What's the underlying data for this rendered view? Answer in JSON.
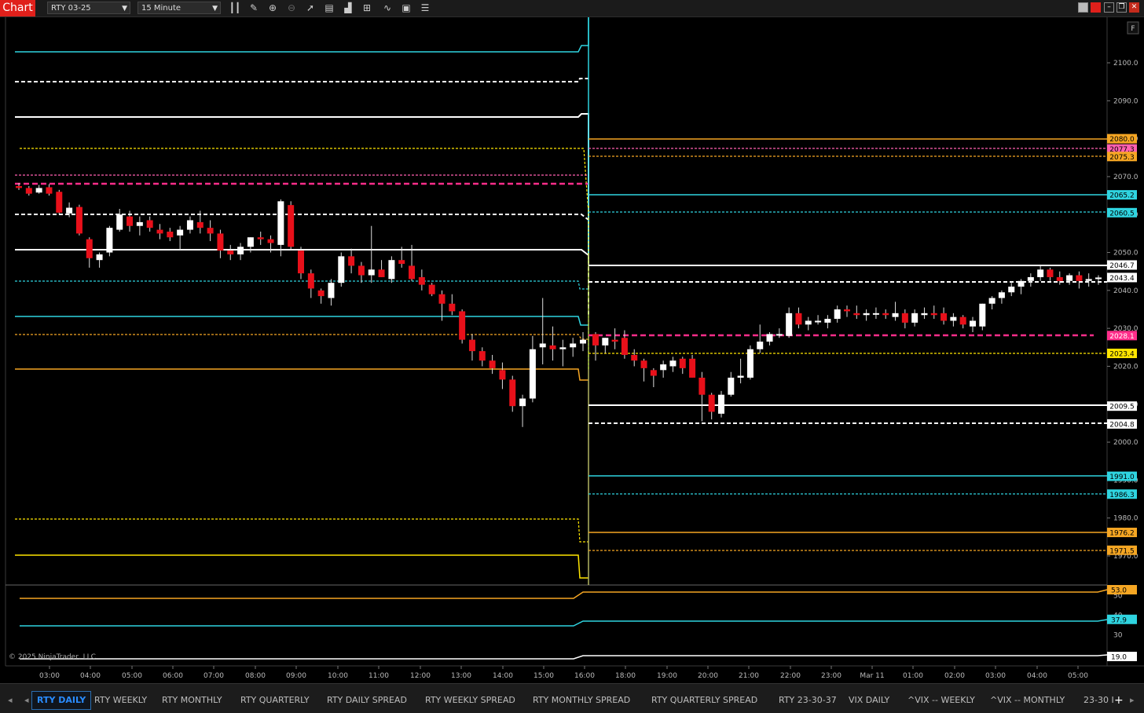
{
  "window": {
    "chart_button": "Chart",
    "instrument": "RTY 03-25",
    "interval": "15 Minute",
    "toolbar_icons": [
      "bars-icon",
      "pencil-icon",
      "zoom-in-icon",
      "zoom-out-icon",
      "pointer-icon",
      "properties-icon",
      "indicators-icon",
      "strategies-icon",
      "drawing-tools-icon",
      "templates-icon",
      "data-box-icon"
    ]
  },
  "price_axis": {
    "ticks": [
      "2100.0",
      "2090.0",
      "2080.0",
      "2070.0",
      "2060.0",
      "2050.0",
      "2040.0",
      "2030.0",
      "2020.0",
      "2010.0",
      "2000.0",
      "1990.0",
      "1980.0",
      "1970.0"
    ],
    "corner_button": "F"
  },
  "price_labels": [
    {
      "text": "2080.0",
      "color": "#f5a623"
    },
    {
      "text": "2077.3",
      "color": "#ff5fb0"
    },
    {
      "text": "2075.3",
      "color": "#f5a623"
    },
    {
      "text": "2065.2",
      "color": "#2fd4e0"
    },
    {
      "text": "2060.5",
      "color": "#2fd4e0"
    },
    {
      "text": "2046.7",
      "color": "#ffffff"
    },
    {
      "text": "2043.4",
      "color": "#ffffff"
    },
    {
      "text": "2028.1",
      "color": "#ff2d8a"
    },
    {
      "text": "2023.4",
      "color": "#ffe600"
    },
    {
      "text": "2009.5",
      "color": "#ffffff"
    },
    {
      "text": "2004.8",
      "color": "#ffffff"
    },
    {
      "text": "1991.0",
      "color": "#2fd4e0"
    },
    {
      "text": "1986.3",
      "color": "#2fd4e0"
    },
    {
      "text": "1976.2",
      "color": "#f5a623"
    },
    {
      "text": "1971.5",
      "color": "#f5a623"
    }
  ],
  "lower_panel": {
    "ticks": [
      "50",
      "40",
      "30"
    ],
    "labels": [
      {
        "text": "53.0",
        "color": "#f5a623"
      },
      {
        "text": "37.9",
        "color": "#2fd4e0"
      },
      {
        "text": "19.0",
        "color": "#ffffff"
      }
    ],
    "copyright": "© 2025 NinjaTrader, LLC"
  },
  "time_axis": [
    "03:00",
    "04:00",
    "05:00",
    "06:00",
    "07:00",
    "08:00",
    "09:00",
    "10:00",
    "11:00",
    "12:00",
    "13:00",
    "14:00",
    "15:00",
    "16:00",
    "18:00",
    "19:00",
    "20:00",
    "21:00",
    "22:00",
    "23:00",
    "Mar 11",
    "01:00",
    "02:00",
    "03:00",
    "04:00",
    "05:00"
  ],
  "tabs": [
    "RTY DAILY",
    "RTY WEEKLY",
    "RTY MONTHLY",
    "RTY QUARTERLY",
    "RTY DAILY SPREAD",
    "RTY WEEKLY SPREAD",
    "RTY MONTHLY SPREAD",
    "RTY QUARTERLY SPREAD",
    "RTY 23-30-37",
    "VIX DAILY",
    "^VIX -- WEEKLY",
    "^VIX -- MONTHLY",
    "23-30 I"
  ],
  "active_tab": "RTY DAILY",
  "colors": {
    "up": "#ffffff",
    "down": "#e8101a",
    "cyan": "#2fd4e0",
    "orange": "#f5a623",
    "magenta": "#ff2d8a",
    "yellow": "#ffe600"
  },
  "candles": [
    [
      2067.5,
      2068.3,
      2066.5,
      2067.0
    ],
    [
      2067.0,
      2067.5,
      2065.0,
      2065.5
    ],
    [
      2065.8,
      2067.8,
      2065.5,
      2067.0
    ],
    [
      2067.2,
      2068.0,
      2065.0,
      2065.5
    ],
    [
      2066.0,
      2066.5,
      2060.0,
      2060.5
    ],
    [
      2060.3,
      2063.2,
      2059.3,
      2061.8
    ],
    [
      2062.0,
      2062.6,
      2054.5,
      2055.0
    ],
    [
      2053.5,
      2054.0,
      2046.0,
      2048.5
    ],
    [
      2048.0,
      2050.0,
      2046.0,
      2049.5
    ],
    [
      2050.0,
      2057.0,
      2049.0,
      2056.5
    ],
    [
      2056.0,
      2061.5,
      2055.5,
      2060.0
    ],
    [
      2059.5,
      2061.0,
      2055.5,
      2057.0
    ],
    [
      2057.0,
      2059.5,
      2054.5,
      2058.0
    ],
    [
      2058.5,
      2059.5,
      2055.5,
      2056.5
    ],
    [
      2056.0,
      2057.5,
      2053.5,
      2055.0
    ],
    [
      2055.5,
      2056.5,
      2053.0,
      2054.0
    ],
    [
      2054.5,
      2057.0,
      2050.5,
      2056.0
    ],
    [
      2056.0,
      2059.5,
      2055.0,
      2058.5
    ],
    [
      2058.0,
      2061.0,
      2055.0,
      2056.5
    ],
    [
      2056.5,
      2058.5,
      2053.0,
      2055.0
    ],
    [
      2055.0,
      2056.0,
      2048.5,
      2050.5
    ],
    [
      2050.5,
      2052.0,
      2048.0,
      2049.5
    ],
    [
      2049.5,
      2052.5,
      2048.0,
      2051.5
    ],
    [
      2051.5,
      2054.0,
      2050.0,
      2054.0
    ],
    [
      2054.0,
      2055.5,
      2052.0,
      2053.5
    ],
    [
      2053.5,
      2054.5,
      2050.0,
      2052.5
    ],
    [
      2052.0,
      2064.0,
      2049.0,
      2063.5
    ],
    [
      2062.5,
      2063.5,
      2050.5,
      2051.5
    ],
    [
      2050.5,
      2051.5,
      2043.0,
      2044.5
    ],
    [
      2044.5,
      2045.5,
      2038.0,
      2040.5
    ],
    [
      2040.0,
      2040.5,
      2036.5,
      2038.5
    ],
    [
      2038.0,
      2043.0,
      2036.0,
      2042.0
    ],
    [
      2042.0,
      2050.0,
      2041.0,
      2049.0
    ],
    [
      2049.0,
      2051.0,
      2044.5,
      2046.5
    ],
    [
      2046.5,
      2047.5,
      2042.0,
      2044.0
    ],
    [
      2044.0,
      2057.0,
      2042.0,
      2045.5
    ],
    [
      2045.5,
      2048.0,
      2043.5,
      2043.5
    ],
    [
      2043.0,
      2049.0,
      2042.0,
      2048.0
    ],
    [
      2048.0,
      2051.5,
      2046.0,
      2047.0
    ],
    [
      2046.5,
      2052.0,
      2042.5,
      2043.0
    ],
    [
      2043.5,
      2045.5,
      2040.0,
      2041.5
    ],
    [
      2041.5,
      2042.0,
      2038.5,
      2039.0
    ],
    [
      2039.0,
      2040.0,
      2032.0,
      2036.5
    ],
    [
      2036.5,
      2039.0,
      2033.5,
      2034.5
    ],
    [
      2034.5,
      2035.0,
      2026.0,
      2027.0
    ],
    [
      2027.0,
      2028.5,
      2021.5,
      2024.0
    ],
    [
      2024.0,
      2025.0,
      2020.0,
      2021.5
    ],
    [
      2021.5,
      2023.0,
      2018.0,
      2019.5
    ],
    [
      2019.0,
      2021.0,
      2014.0,
      2016.5
    ],
    [
      2016.5,
      2017.5,
      2008.0,
      2009.5
    ],
    [
      2009.5,
      2012.5,
      2004.0,
      2011.5
    ],
    [
      2011.5,
      2028.0,
      2010.5,
      2024.5
    ],
    [
      2025.0,
      2038.0,
      2020.5,
      2026.0
    ],
    [
      2025.5,
      2030.5,
      2021.5,
      2024.5
    ],
    [
      2024.5,
      2027.0,
      2020.0,
      2025.0
    ],
    [
      2025.0,
      2027.5,
      2022.5,
      2026.0
    ],
    [
      2026.0,
      2029.0,
      2024.0,
      2027.0
    ],
    [
      2028.5,
      2029.0,
      2021.5,
      2025.5
    ],
    [
      2025.5,
      2027.5,
      2023.5,
      2027.5
    ],
    [
      2027.0,
      2030.0,
      2024.5,
      2026.5
    ],
    [
      2027.5,
      2029.5,
      2022.0,
      2023.0
    ],
    [
      2023.0,
      2024.5,
      2020.0,
      2021.5
    ],
    [
      2021.5,
      2022.0,
      2016.0,
      2019.5
    ],
    [
      2019.0,
      2019.5,
      2014.5,
      2017.5
    ],
    [
      2019.0,
      2021.5,
      2017.0,
      2020.5
    ],
    [
      2020.0,
      2022.5,
      2018.5,
      2021.5
    ],
    [
      2022.0,
      2022.5,
      2018.0,
      2019.5
    ],
    [
      2022.0,
      2023.0,
      2017.0,
      2017.0
    ],
    [
      2017.0,
      2018.5,
      2005.5,
      2012.5
    ],
    [
      2012.5,
      2013.0,
      2006.0,
      2008.0
    ],
    [
      2007.5,
      2013.5,
      2006.5,
      2012.5
    ],
    [
      2012.5,
      2018.5,
      2012.0,
      2017.0
    ],
    [
      2017.0,
      2022.0,
      2015.5,
      2017.5
    ],
    [
      2017.0,
      2025.5,
      2016.5,
      2024.5
    ],
    [
      2024.5,
      2031.0,
      2023.5,
      2026.5
    ],
    [
      2026.5,
      2029.0,
      2025.5,
      2028.5
    ],
    [
      2028.5,
      2030.0,
      2027.5,
      2028.5
    ],
    [
      2028.0,
      2035.5,
      2027.5,
      2034.0
    ],
    [
      2034.0,
      2035.5,
      2030.0,
      2031.0
    ],
    [
      2031.0,
      2033.0,
      2029.5,
      2032.0
    ],
    [
      2032.0,
      2033.5,
      2031.0,
      2032.0
    ],
    [
      2031.5,
      2033.5,
      2030.0,
      2032.5
    ],
    [
      2032.5,
      2036.0,
      2031.5,
      2035.0
    ],
    [
      2035.0,
      2036.0,
      2033.0,
      2034.5
    ],
    [
      2034.0,
      2036.0,
      2032.5,
      2033.5
    ],
    [
      2033.5,
      2035.0,
      2032.0,
      2034.0
    ],
    [
      2034.0,
      2035.5,
      2032.5,
      2034.0
    ],
    [
      2034.0,
      2035.0,
      2032.5,
      2033.5
    ],
    [
      2033.0,
      2037.0,
      2032.0,
      2034.0
    ],
    [
      2034.0,
      2035.0,
      2030.0,
      2031.5
    ],
    [
      2031.5,
      2035.0,
      2030.5,
      2034.0
    ],
    [
      2033.5,
      2035.5,
      2032.5,
      2034.0
    ],
    [
      2034.0,
      2036.0,
      2032.5,
      2033.5
    ],
    [
      2034.0,
      2035.5,
      2031.0,
      2032.0
    ],
    [
      2032.0,
      2034.0,
      2030.5,
      2033.0
    ],
    [
      2033.0,
      2033.5,
      2030.0,
      2031.0
    ],
    [
      2030.5,
      2033.0,
      2029.0,
      2032.0
    ],
    [
      2030.5,
      2036.5,
      2029.5,
      2036.5
    ],
    [
      2036.5,
      2038.5,
      2035.0,
      2038.0
    ],
    [
      2038.0,
      2040.0,
      2036.5,
      2039.5
    ],
    [
      2039.5,
      2042.0,
      2038.5,
      2041.0
    ],
    [
      2041.0,
      2043.0,
      2039.0,
      2042.5
    ],
    [
      2042.5,
      2044.5,
      2041.0,
      2043.5
    ],
    [
      2043.5,
      2046.5,
      2042.5,
      2045.5
    ],
    [
      2045.5,
      2046.0,
      2042.5,
      2043.5
    ],
    [
      2043.5,
      2045.0,
      2041.5,
      2042.5
    ],
    [
      2042.5,
      2044.5,
      2041.5,
      2044.0
    ],
    [
      2044.0,
      2045.0,
      2040.5,
      2042.5
    ],
    [
      2042.5,
      2044.5,
      2041.0,
      2043.0
    ],
    [
      2043.0,
      2044.0,
      2041.5,
      2043.4
    ]
  ],
  "session_break_index": 57
}
